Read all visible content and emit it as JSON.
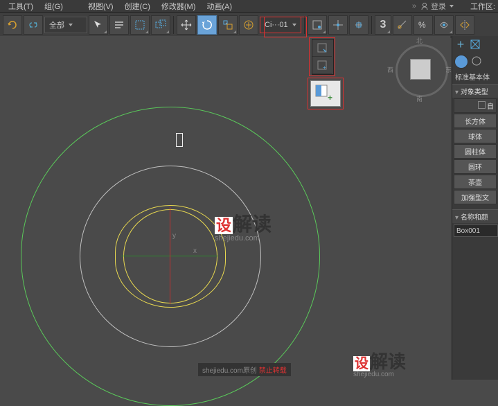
{
  "menu": {
    "tools": "工具(T)",
    "group": "组(G)",
    "view": "视图(V)",
    "create": "创建(C)",
    "modifier": "修改器(M)",
    "anim": "动画(A)",
    "login": "登录",
    "workspace": "工作区:"
  },
  "toolbar": {
    "filter_label": "全部",
    "obj_label": "Ci···01"
  },
  "viewport": {
    "axis_x": "x",
    "axis_y": "y"
  },
  "viewcube": {
    "n": "北",
    "s": "南",
    "e": "东",
    "w": "西"
  },
  "panel": {
    "category": "标准基本体",
    "sec_objtype": "对象类型",
    "autogrid": "自",
    "btn_box": "长方体",
    "btn_sphere": "球体",
    "btn_cylinder": "圆柱体",
    "btn_torus": "圆环",
    "btn_teapot": "茶壶",
    "btn_text": "加强型文",
    "sec_name": "名称和颜",
    "obj_name": "Box001"
  },
  "watermark": {
    "wm1a": "设",
    "wm1b": "解读",
    "wm1c": "shejiedu.com",
    "footer_a": "shejiedu.com原创 ",
    "footer_b": "禁止转载"
  }
}
